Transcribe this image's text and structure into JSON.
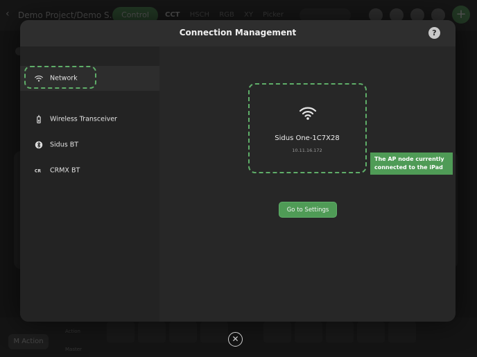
{
  "background_app": {
    "project_title": "Demo Project/Demo S...",
    "control_tab": "Control",
    "mode_tabs": [
      "CCT",
      "HSCH",
      "RGB",
      "XY",
      "Picker"
    ],
    "action_button": "M Action",
    "bottom_labels": [
      "Action",
      "Master"
    ]
  },
  "modal": {
    "title": "Connection Management",
    "help_icon": "help-icon",
    "sidebar": [
      {
        "label": "Network",
        "icon": "wifi-icon",
        "active": true
      },
      {
        "label": "Wireless Transceiver",
        "icon": "transceiver-icon",
        "active": false
      },
      {
        "label": "Sidus BT",
        "icon": "bluetooth-icon",
        "active": false
      },
      {
        "label": "CRMX BT",
        "icon": "crmx-icon",
        "active": false
      }
    ],
    "node": {
      "name": "Sidus One-1C7X28",
      "ip": "10.11.16.172"
    },
    "settings_button": "Go to Settings"
  },
  "annotation": {
    "callout": "The AP node currently connected to the iPad"
  },
  "colors": {
    "accent": "#4f9b56",
    "highlight_dash": "#5fae69",
    "modal_bg": "#272727"
  }
}
